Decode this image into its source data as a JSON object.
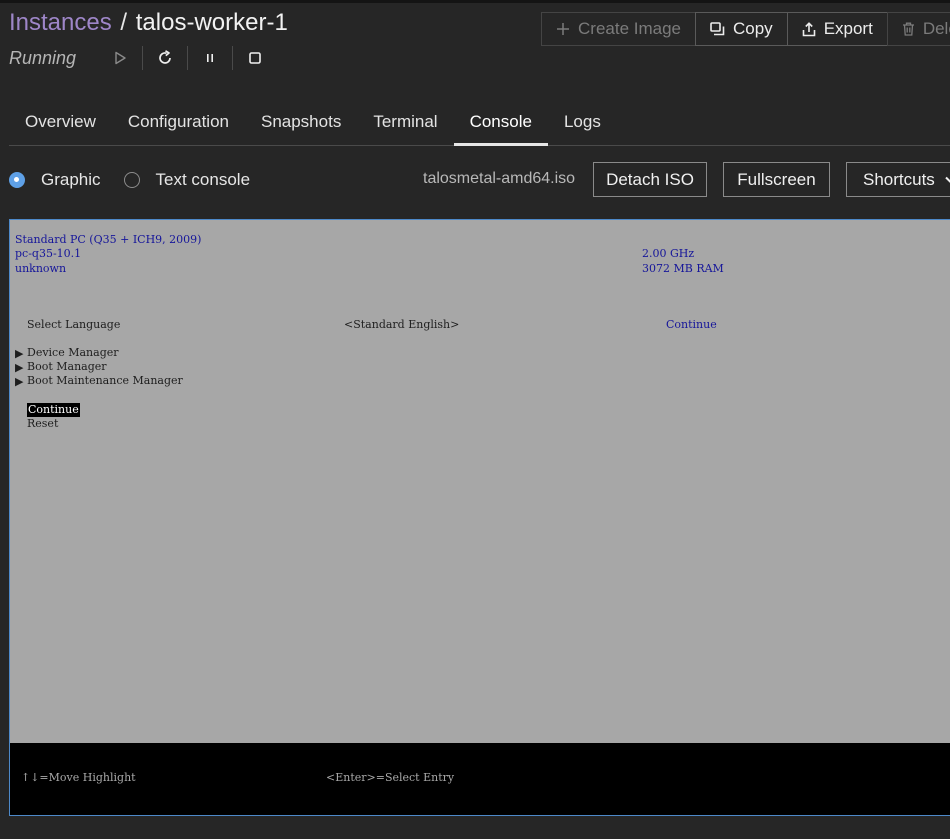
{
  "header": {
    "breadcrumb_root": "Instances",
    "breadcrumb_sep": "/",
    "instance_name": "talos-worker-1",
    "status": "Running"
  },
  "actions": {
    "create_image": "Create Image",
    "copy": "Copy",
    "export": "Export",
    "delete": "Delete"
  },
  "tabs": [
    "Overview",
    "Configuration",
    "Snapshots",
    "Terminal",
    "Console",
    "Logs"
  ],
  "active_tab": "Console",
  "console": {
    "mode_graphic": "Graphic",
    "mode_text": "Text console",
    "selected_mode": "Graphic",
    "iso_name": "talosmetal-amd64.iso",
    "detach_iso": "Detach ISO",
    "fullscreen": "Fullscreen",
    "shortcuts": "Shortcuts"
  },
  "bios": {
    "machine": "Standard PC (Q35 + ICH9, 2009)",
    "version": "pc-q35-10.1",
    "serial": "unknown",
    "cpu": "2.00 GHz",
    "ram": "3072 MB RAM",
    "select_language": "Select Language",
    "language_value": "<Standard English>",
    "help_continue": "Continue",
    "menu": [
      "Device Manager",
      "Boot Manager",
      "Boot Maintenance Manager"
    ],
    "continue": "Continue",
    "reset": "Reset",
    "footer_move": "↑↓=Move Highlight",
    "footer_enter": "<Enter>=Select Entry"
  },
  "colors": {
    "accent_purple": "#9e86c8",
    "radio_blue": "#5ea0e6",
    "bios_blue": "#16169a",
    "bios_bg": "#a7a7a7"
  }
}
